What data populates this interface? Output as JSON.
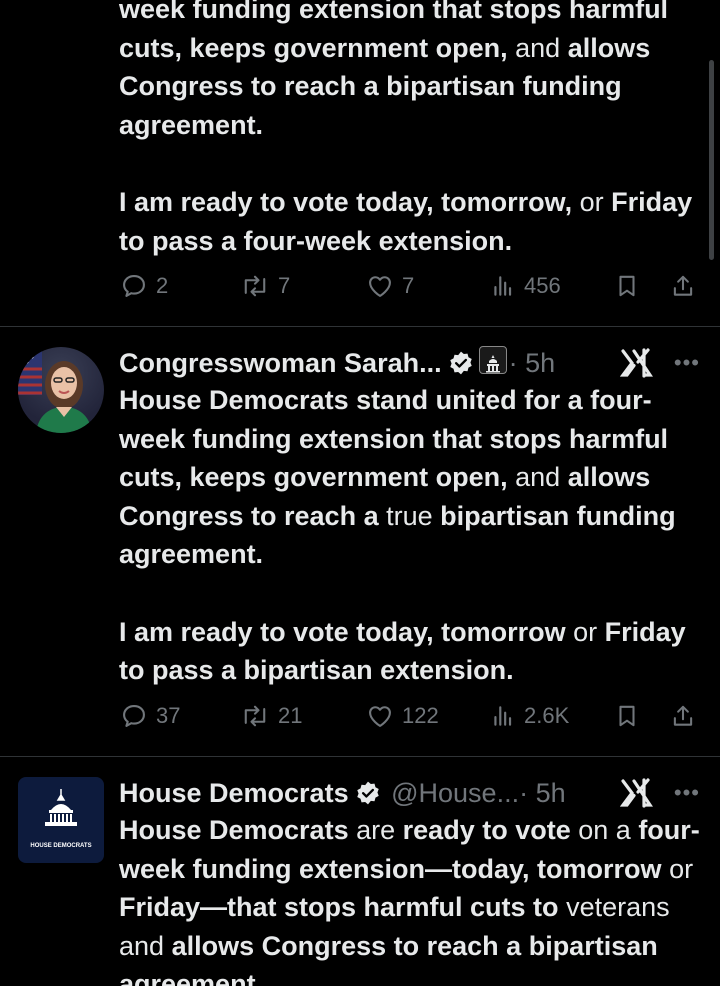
{
  "tweets": [
    {
      "text_bold_1": "week funding extension that stops harmful cuts, keeps government open,",
      "text_plain_1": "and",
      "text_bold_2": "allows Congress to reach a bipartisan funding agreement.",
      "text_bold_3": "I am ready to vote today, tomorrow,",
      "text_plain_2": "or",
      "text_bold_4": "Friday to pass a four-week extension.",
      "replies": "2",
      "reposts": "7",
      "likes": "7",
      "views": "456"
    },
    {
      "name": "Congresswoman Sarah...",
      "time": "· 5h",
      "text_bold_1": "House Democrats stand united for a four-week funding extension that stops harmful cuts, keeps government open,",
      "text_plain_1": "and",
      "text_bold_2": "allows Congress to reach  a",
      "text_plain_2": "true",
      "text_bold_3": "bipartisan funding agreement.",
      "text_bold_4": "I am ready to vote today, tomorrow",
      "text_plain_3": "or",
      "text_bold_5": "Friday to pass a bipartisan extension.",
      "replies": "37",
      "reposts": "21",
      "likes": "122",
      "views": "2.6K"
    },
    {
      "name": "House Democrats",
      "handle": "@House...",
      "time": "· 5h",
      "logo_text": "HOUSE DEMOCRATS",
      "seg1": "House Democrats",
      "seg2": "are",
      "seg3": "ready to vote",
      "seg4": "on a",
      "seg5": "four-week funding extension—today, tomorrow",
      "seg6": "or",
      "seg7": "Friday—that stops harmful cuts to",
      "seg8": "veterans and",
      "seg9": "allows Congress to reach a bipartisan agreement."
    }
  ],
  "colors": {
    "background": "#000000",
    "text": "#e7e9ea",
    "muted": "#71767b",
    "verified": "#e7e9ea",
    "divider": "#2f3336"
  },
  "icons": [
    "reply-icon",
    "repost-icon",
    "like-icon",
    "views-icon",
    "bookmark-icon",
    "share-icon",
    "verified-icon",
    "grok-icon",
    "more-icon"
  ]
}
